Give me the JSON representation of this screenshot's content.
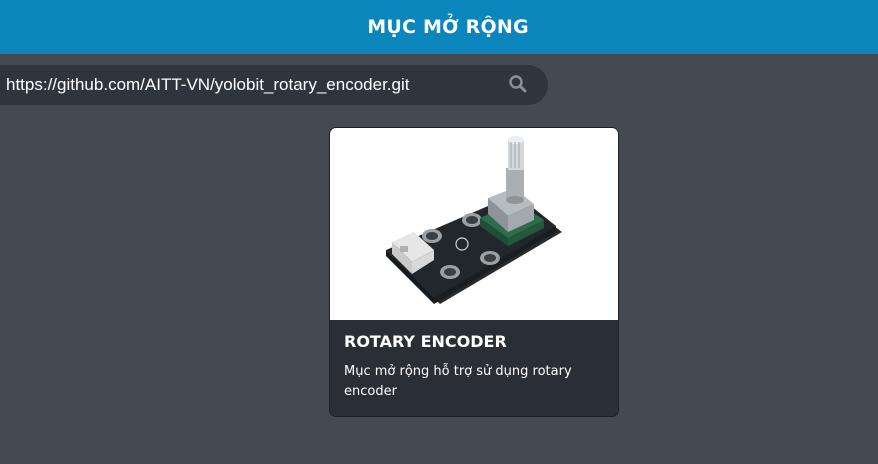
{
  "header": {
    "title": "MỤC MỞ RỘNG"
  },
  "search": {
    "value": "https://github.com/AITT-VN/yolobit_rotary_encoder.git",
    "icon": "search-icon"
  },
  "extensions": [
    {
      "title": "ROTARY ENCODER",
      "description": "Mục mở rộng hỗ trợ sử dụng rotary encoder",
      "image": "rotary-encoder-module-image"
    }
  ],
  "colors": {
    "header_bg": "#0a86bd",
    "page_bg": "#434a52",
    "search_bg": "#2f353d",
    "card_body_bg": "#2a2f36"
  }
}
